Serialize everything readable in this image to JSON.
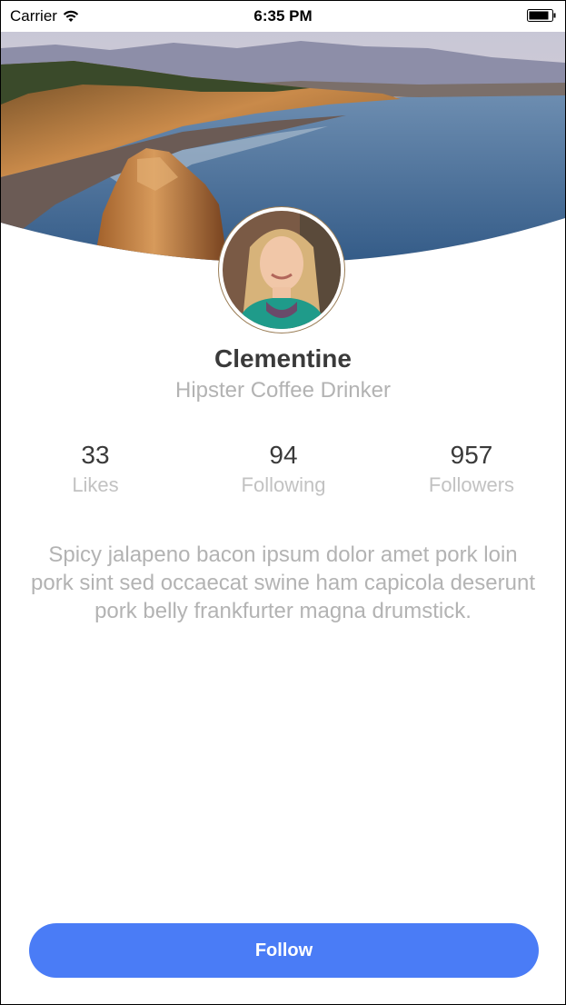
{
  "status_bar": {
    "carrier": "Carrier",
    "time": "6:35 PM"
  },
  "profile": {
    "name": "Clementine",
    "title": "Hipster Coffee Drinker"
  },
  "stats": [
    {
      "value": "33",
      "label": "Likes"
    },
    {
      "value": "94",
      "label": "Following"
    },
    {
      "value": "957",
      "label": "Followers"
    }
  ],
  "bio": "Spicy jalapeno bacon ipsum dolor amet pork loin pork sint sed occaecat swine ham capicola deserunt pork belly frankfurter magna drumstick.",
  "actions": {
    "follow_label": "Follow"
  },
  "colors": {
    "accent": "#4a7cf6",
    "name_text": "#3a3a3a",
    "muted_text": "#b3b3b3"
  },
  "icons": {
    "signal": "wifi-icon",
    "battery": "battery-icon"
  }
}
